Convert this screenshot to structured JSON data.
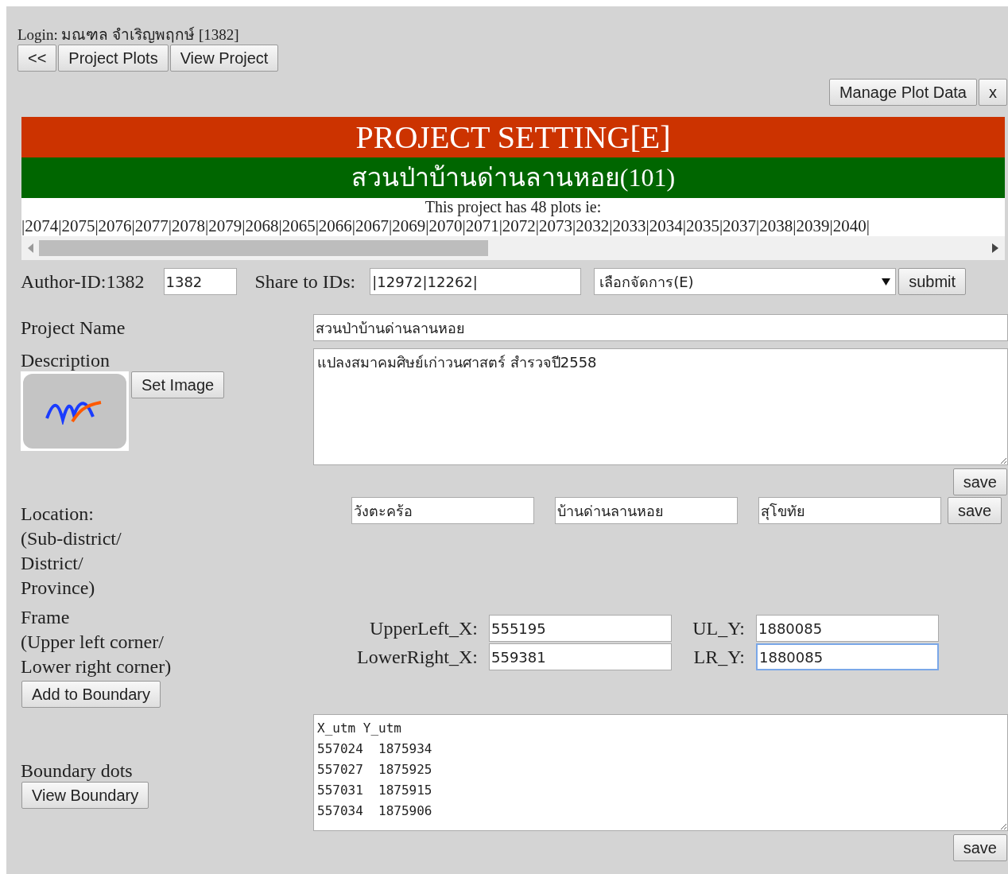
{
  "login": "Login: มณฑล จำเริญพฤกษ์ [1382]",
  "nav_buttons": [
    "<<",
    "Project Plots",
    "View Project"
  ],
  "top_right_buttons": [
    "Manage Plot Data",
    "x"
  ],
  "header": {
    "title": "PROJECT SETTING[E]",
    "subtitle": "สวนป่าบ้านด่านลานหอย(101)"
  },
  "plots": {
    "summary": "This project has 48 plots ie:",
    "ids": "|2074|2075|2076|2077|2078|2079|2068|2065|2066|2067|2069|2070|2071|2072|2073|2032|2033|2034|2035|2037|2038|2039|2040|"
  },
  "author": {
    "label": "Author-ID:1382",
    "value": "1382"
  },
  "share": {
    "label": "Share to IDs:",
    "value": "|12972|12262|"
  },
  "action_select": {
    "value": "เลือกจัดการ(E)"
  },
  "submit": "submit",
  "project_name": {
    "label": "Project Name",
    "value": "สวนป่าบ้านด่านลานหอย"
  },
  "description": {
    "label": "Description",
    "value": "แปลงสมาคมศิษย์เก่าวนศาสตร์ สำรวจปี2558",
    "set_image": "Set Image",
    "save": "save"
  },
  "location": {
    "label_lines": [
      "Location:",
      "(Sub-district/",
      "District/",
      "Province)"
    ],
    "values": [
      "วังตะคร้อ",
      "บ้านด่านลานหอย",
      "สุโขทัย"
    ],
    "save": "save"
  },
  "frame": {
    "label_lines": [
      "Frame",
      "(Upper left corner/",
      "Lower right corner)"
    ],
    "add_button": "Add to Boundary",
    "fields": [
      {
        "label": "UpperLeft_X:",
        "value": "555195",
        "focused": false
      },
      {
        "label": "UL_Y:",
        "value": "1880085",
        "focused": false
      },
      {
        "label": "LowerRight_X:",
        "value": "559381",
        "focused": false
      },
      {
        "label": "LR_Y:",
        "value": "1880085",
        "focused": true
      }
    ]
  },
  "boundary": {
    "label": "Boundary dots",
    "view_button": "View Boundary",
    "lines": [
      "X_utm Y_utm",
      "557024  1875934",
      "557027  1875925",
      "557031  1875915",
      "557034  1875906"
    ],
    "save": "save"
  }
}
